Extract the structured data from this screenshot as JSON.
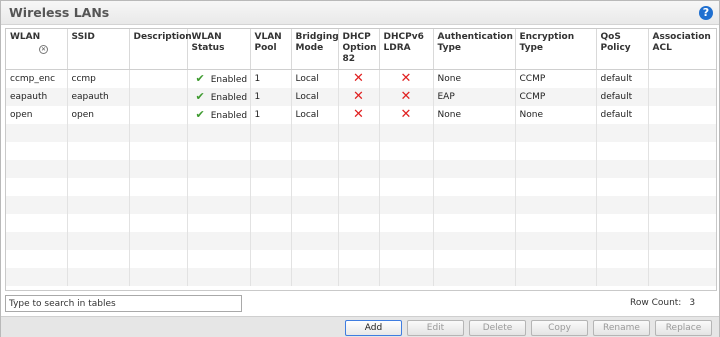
{
  "panel": {
    "title": "Wireless LANs",
    "help_icon": "?"
  },
  "table": {
    "columns": [
      "WLAN",
      "SSID",
      "Description",
      "WLAN Status",
      "VLAN Pool",
      "Bridging Mode",
      "DHCP Option 82",
      "DHCPv6 LDRA",
      "Authentication Type",
      "Encryption Type",
      "QoS Policy",
      "Association ACL"
    ],
    "rows": [
      {
        "wlan": "ccmp_enc",
        "ssid": "ccmp",
        "description": "",
        "status": "Enabled",
        "vlan_pool": "1",
        "bridging": "Local",
        "dhcp82": false,
        "dhcpv6": false,
        "auth": "None",
        "encryption": "CCMP",
        "qos": "default",
        "acl": ""
      },
      {
        "wlan": "eapauth",
        "ssid": "eapauth",
        "description": "",
        "status": "Enabled",
        "vlan_pool": "1",
        "bridging": "Local",
        "dhcp82": false,
        "dhcpv6": false,
        "auth": "EAP",
        "encryption": "CCMP",
        "qos": "default",
        "acl": ""
      },
      {
        "wlan": "open",
        "ssid": "open",
        "description": "",
        "status": "Enabled",
        "vlan_pool": "1",
        "bridging": "Local",
        "dhcp82": false,
        "dhcpv6": false,
        "auth": "None",
        "encryption": "None",
        "qos": "default",
        "acl": ""
      }
    ],
    "status_icon": "check-icon",
    "false_icon": "cross-icon"
  },
  "search": {
    "placeholder": "Type to search in tables"
  },
  "row_count": {
    "label": "Row Count:",
    "value": "3"
  },
  "buttons": {
    "add": "Add",
    "edit": "Edit",
    "delete": "Delete",
    "copy": "Copy",
    "rename": "Rename",
    "replace": "Replace"
  },
  "colors": {
    "accent": "#3f7de0",
    "help": "#1f6fd0",
    "check": "#3d9a2e",
    "cross": "#e02020"
  }
}
